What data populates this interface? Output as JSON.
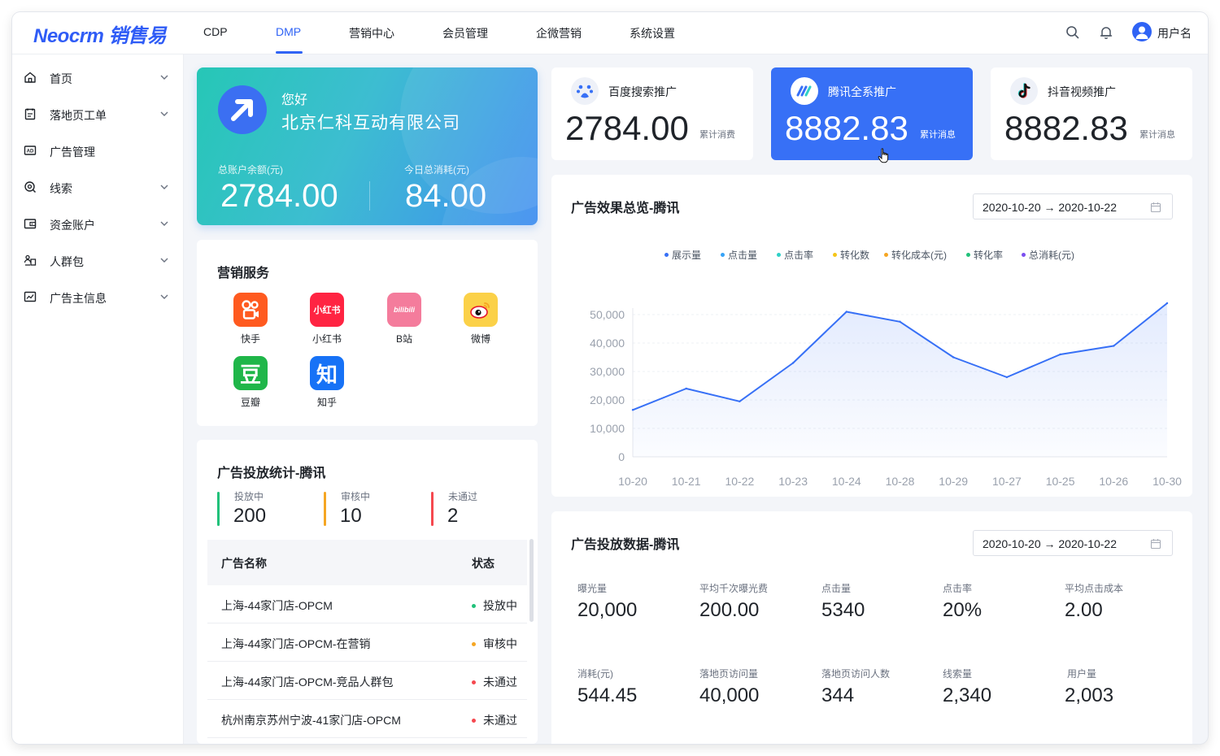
{
  "brand": {
    "logo": "Neocrm 销售易"
  },
  "top_nav": [
    {
      "label": "CDP"
    },
    {
      "label": "DMP"
    },
    {
      "label": "营销中心"
    },
    {
      "label": "会员管理"
    },
    {
      "label": "企微营销"
    },
    {
      "label": "系统设置"
    }
  ],
  "top_nav_active": "DMP",
  "user": {
    "name": "用户名"
  },
  "sidebar": {
    "items": [
      {
        "label": "首页",
        "icon": "home-icon",
        "expandable": true
      },
      {
        "label": "落地页工单",
        "icon": "clipboard-icon",
        "expandable": true
      },
      {
        "label": "广告管理",
        "icon": "ad-icon",
        "expandable": false
      },
      {
        "label": "线索",
        "icon": "search-target-icon",
        "expandable": true
      },
      {
        "label": "资金账户",
        "icon": "wallet-icon",
        "expandable": true
      },
      {
        "label": "人群包",
        "icon": "people-icon",
        "expandable": true
      },
      {
        "label": "广告主信息",
        "icon": "chart-icon",
        "expandable": true
      }
    ]
  },
  "welcome": {
    "greeting": "您好",
    "company": "北京仁科互动有限公司",
    "balance_label": "总账户余额(元)",
    "balance": "2784.00",
    "today_label": "今日总消耗(元)",
    "today": "84.00"
  },
  "promo_cards": [
    {
      "title": "百度搜索推广",
      "value": "2784.00",
      "sub": "累计消费",
      "icon": "baidu-icon",
      "active": false
    },
    {
      "title": "腾讯全系推广",
      "value": "8882.83",
      "sub": "累计消息",
      "icon": "tencent-ads-icon",
      "active": true
    },
    {
      "title": "抖音视频推广",
      "value": "8882.83",
      "sub": "累计消息",
      "icon": "douyin-icon",
      "active": false
    }
  ],
  "services": {
    "title": "营销服务",
    "items": [
      {
        "label": "快手",
        "glyph": "快",
        "color": "#ff5a1f"
      },
      {
        "label": "小红书",
        "glyph": "小红书",
        "color": "#ff2442"
      },
      {
        "label": "B站",
        "glyph": "bilibili",
        "color": "#f47c9c"
      },
      {
        "label": "微博",
        "glyph": "微",
        "color": "#f5a623"
      },
      {
        "label": "豆瓣",
        "glyph": "豆",
        "color": "#1fb649"
      },
      {
        "label": "知乎",
        "glyph": "知",
        "color": "#1772f6"
      }
    ]
  },
  "ad_stats": {
    "title": "广告投放统计-腾讯",
    "items": [
      {
        "label": "投放中",
        "value": "200",
        "color": "#21c17a"
      },
      {
        "label": "审核中",
        "value": "10",
        "color": "#f5a623"
      },
      {
        "label": "未通过",
        "value": "2",
        "color": "#f5484f"
      }
    ],
    "columns": [
      "广告名称",
      "状态"
    ],
    "rows": [
      {
        "name": "上海-44家门店-OPCM",
        "status": "投放中",
        "color": "#21c17a"
      },
      {
        "name": "上海-44家门店-OPCM-在营销",
        "status": "审核中",
        "color": "#f5a623"
      },
      {
        "name": "上海-44家门店-OPCM-竞品人群包",
        "status": "未通过",
        "color": "#f5484f"
      },
      {
        "name": "杭州南京苏州宁波-41家门店-OPCM",
        "status": "未通过",
        "color": "#f5484f"
      }
    ]
  },
  "overview": {
    "title": "广告效果总览-腾讯",
    "date_range": "2020-10-20 → 2020-10-22",
    "legend": [
      {
        "label": "展示量",
        "color": "#3770f6"
      },
      {
        "label": "点击量",
        "color": "#36a3f7"
      },
      {
        "label": "点击率",
        "color": "#2fd0c7"
      },
      {
        "label": "转化数",
        "color": "#f5c518"
      },
      {
        "label": "转化成本(元)",
        "color": "#f5a623"
      },
      {
        "label": "转化率",
        "color": "#21c17a"
      },
      {
        "label": "总消耗(元)",
        "color": "#7b4ef0"
      }
    ]
  },
  "chart_data": {
    "type": "area",
    "x": [
      "10-20",
      "10-21",
      "10-22",
      "10-23",
      "10-24",
      "10-28",
      "10-29",
      "10-27",
      "10-25",
      "10-26",
      "10-30"
    ],
    "series": [
      {
        "values": [
          16500,
          24000,
          19500,
          33000,
          51000,
          47500,
          35000,
          28000,
          36000,
          39000,
          54000
        ]
      }
    ],
    "yticks": [
      "50,000",
      "40,000",
      "30,000",
      "20,000",
      "10,000",
      "0"
    ],
    "ylim": [
      0,
      50000
    ],
    "grid": true,
    "line_color": "#3770f6"
  },
  "ad_data": {
    "title": "广告投放数据-腾讯",
    "date_range": "2020-10-20 → 2020-10-22",
    "metrics": [
      {
        "label": "曝光量",
        "value": "20,000"
      },
      {
        "label": "平均千次曝光费",
        "value": "200.00"
      },
      {
        "label": "点击量",
        "value": "5340"
      },
      {
        "label": "点击率",
        "value": "20%"
      },
      {
        "label": "平均点击成本",
        "value": "2.00"
      },
      {
        "label": "消耗(元)",
        "value": "544.45"
      },
      {
        "label": "落地页访问量",
        "value": "40,000"
      },
      {
        "label": "落地页访问人数",
        "value": "344"
      },
      {
        "label": "线索量",
        "value": "2,340"
      },
      {
        "label": "用户量",
        "value": "2,003"
      }
    ]
  }
}
